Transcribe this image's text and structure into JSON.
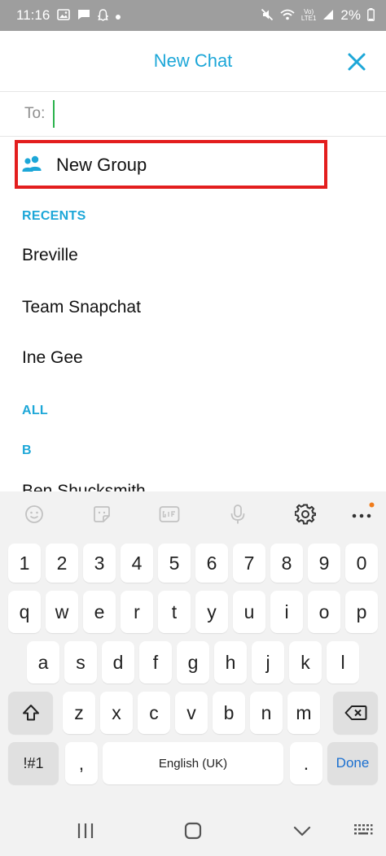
{
  "status_bar": {
    "time": "11:16",
    "battery": "2%",
    "network_top": "Vo)",
    "network_bottom": "LTE1"
  },
  "header": {
    "title": "New Chat"
  },
  "to_row": {
    "label": "To:",
    "value": "",
    "placeholder": ""
  },
  "new_group": {
    "label": "New Group"
  },
  "sections": {
    "recents": "RECENTS",
    "all": "ALL",
    "letter_b": "B"
  },
  "recents": [
    {
      "name": "Breville"
    },
    {
      "name": "Team Snapchat"
    },
    {
      "name": "Ine Gee"
    }
  ],
  "all_contacts": [
    {
      "name": "Ben Shucksmith"
    }
  ],
  "keyboard": {
    "row_numbers": [
      "1",
      "2",
      "3",
      "4",
      "5",
      "6",
      "7",
      "8",
      "9",
      "0"
    ],
    "row_top": [
      "q",
      "w",
      "e",
      "r",
      "t",
      "y",
      "u",
      "i",
      "o",
      "p"
    ],
    "row_middle": [
      "a",
      "s",
      "d",
      "f",
      "g",
      "h",
      "j",
      "k",
      "l"
    ],
    "row_bottom": [
      "z",
      "x",
      "c",
      "v",
      "b",
      "n",
      "m"
    ],
    "symbols_key": "!#1",
    "comma_key": ",",
    "space_label": "English (UK)",
    "period_key": ".",
    "done_label": "Done"
  },
  "colors": {
    "accent": "#1da7d8",
    "highlight_border": "#e31e1e",
    "cursor": "#2bb24c",
    "done": "#1a6fd0",
    "status_bar": "#9e9e9e",
    "notification_dot": "#f07c1b"
  }
}
